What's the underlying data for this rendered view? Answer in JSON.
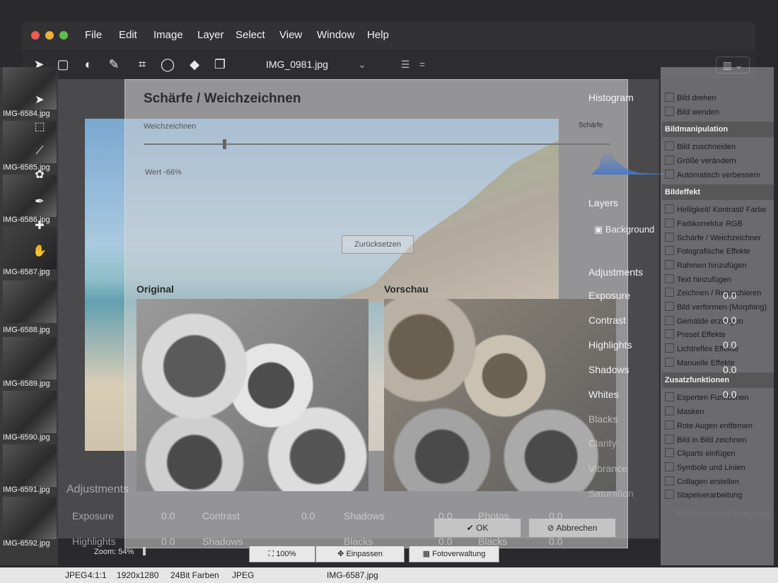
{
  "menubar": {
    "items": [
      "File",
      "Edit",
      "Image",
      "Layer",
      "Select",
      "View",
      "Window",
      "Help"
    ]
  },
  "toolbar": {
    "file_select": "IMG_0981.jpg"
  },
  "thumbnails": [
    "IMG-6584.jpg",
    "IMG-6585.jpg",
    "IMG-6586.jpg",
    "IMG-6587.jpg",
    "IMG-6588.jpg",
    "IMG-6589.jpg",
    "IMG-6590.jpg",
    "IMG-6591.jpg",
    "IMG-6592.jpg"
  ],
  "dialog": {
    "title": "Schärfe / Weichzeichnen",
    "slider_label": "Weichzeichnen",
    "slider_value_text": "Wert -66%",
    "slider_level": 0.17,
    "reset_label": "Zurücksetzen",
    "original_label": "Original",
    "preview_label": "Vorschau",
    "ok_label": "OK",
    "cancel_label": "Abbrechen"
  },
  "right_panel": {
    "histogram_title": "Histogram",
    "scharfe_label": "Schärfe",
    "layers_title": "Layers",
    "layer_name": "Background",
    "adjustments_title": "Adjustments",
    "adjustments": [
      "Exposure",
      "Contrast",
      "Highlights",
      "Shadows",
      "Whites",
      "Blacks",
      "Clarity",
      "Vibrance",
      "Saturation"
    ],
    "zero_values": [
      "0.0",
      "0.0",
      "0.0",
      "0.0",
      "0.0"
    ]
  },
  "german_menu": {
    "top_items": [
      "Bild drehen",
      "Bild wenden"
    ],
    "sections": [
      {
        "title": "Bildmanipulation",
        "items": [
          "Bild zuschneiden",
          "Größe verändern",
          "Automatisch verbessern"
        ]
      },
      {
        "title": "Bildeffekt",
        "items": [
          "Helligkeit/ Kontrast/ Farbe",
          "Farbkorrektur RGB",
          "Schärfe / Weichzeichner",
          "Fotografische Effekte",
          "Rahmen hinzufügen",
          "Text hinzufügen",
          "Zeichnen / Retuschieren",
          "Bild verformen (Morphing)",
          "Gemälde erzeugen",
          "Preset Effekte",
          "Lichtreflex Effekte",
          "Manuelle Effekte"
        ]
      },
      {
        "title": "Zusatzfunktionen",
        "items": [
          "Experten Funktionen",
          "Masken",
          "Rote Augen entfernen",
          "Bild in Bild zeichnen",
          "Cliparts einfügen",
          "Symbole und Linien",
          "Collagen erstellen",
          "Stapelverarbeitung"
        ]
      }
    ],
    "undo": "Bildbearbeitung rückgängig"
  },
  "ghost_panel": {
    "title": "Adjustments",
    "labels": [
      "Exposure",
      "Contrast",
      "Shadows",
      "Photos",
      "Highlights",
      "Shadows",
      "Blacks",
      "Blacks"
    ],
    "values": [
      "0.0",
      "0.0",
      "0.0",
      "0.0",
      "0.0",
      "0.0",
      "0.0"
    ]
  },
  "zoom_bar": {
    "zoom_label": "Zoom: 54%",
    "btn_100": "100%",
    "btn_fit": "Einpassen",
    "btn_manager": "Fotoverwaltung"
  },
  "status_bar": {
    "format": "JPEG",
    "sampling": "4:1:1",
    "dimensions": "1920x1280",
    "colors": "24Bit Farben",
    "type": "JPEG",
    "filename": "IMG-6587.jpg"
  }
}
